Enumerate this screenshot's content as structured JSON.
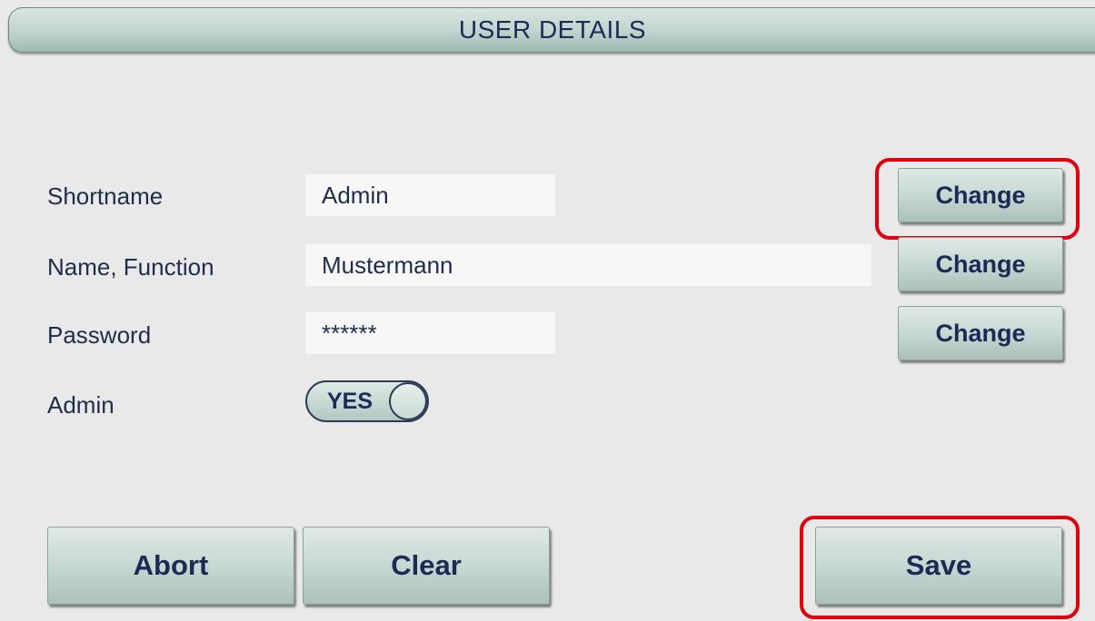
{
  "header": {
    "title": "USER DETAILS"
  },
  "form": {
    "shortname_label": "Shortname",
    "shortname_value": "Admin",
    "name_label": "Name, Function",
    "name_value": "Mustermann",
    "password_label": "Password",
    "password_value": "******",
    "admin_label": "Admin",
    "admin_toggle_text": "YES",
    "admin_enabled": true,
    "change_label": "Change"
  },
  "actions": {
    "abort_label": "Abort",
    "clear_label": "Clear",
    "save_label": "Save"
  },
  "colors": {
    "highlight": "#e0000f",
    "button_text": "#1c2a55",
    "background": "#e9e9e9"
  }
}
